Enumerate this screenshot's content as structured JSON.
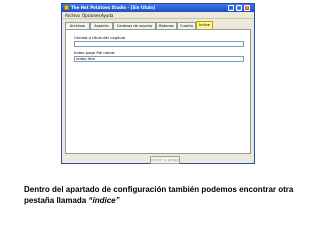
{
  "window": {
    "title": "The Hot Potatoes Studio - [Sin título]",
    "controls": {
      "minimize": "_",
      "maximize": "□",
      "close": "×"
    }
  },
  "menu": [
    "Archivo",
    "Opciones",
    "Ayuda"
  ],
  "tabs": [
    "Archivos",
    "Aspecto",
    "Cadenas de usuario",
    "Botones",
    "Cuenta",
    "Índice"
  ],
  "active_tab": "Índice",
  "fields": {
    "first_label": "Unidad o título del capítulo",
    "second_label": "Index page file name:",
    "second_value": "index.htm"
  },
  "panel_button": "Cerrar y grabar",
  "caption": {
    "line1": "Dentro del apartado de configuración también podemos encontrar otra",
    "line2_prefix": "pestaña llamada ",
    "line2_emph": "“índice”"
  },
  "colors": {
    "title_bar": "#1c4fc6",
    "active_tab": "#fff58a",
    "panel_bg": "#ffffff",
    "window_bg": "#ece9d8"
  }
}
